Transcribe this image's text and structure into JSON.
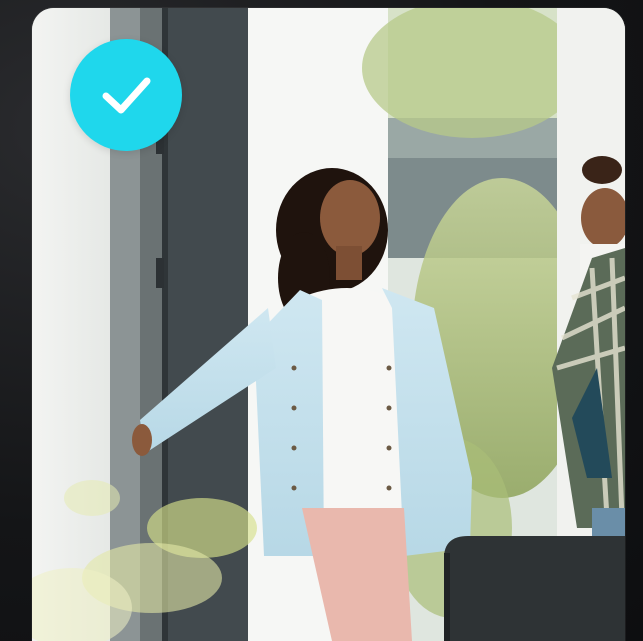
{
  "card": {
    "selected": true,
    "badge_icon": "checkmark-icon",
    "badge_color": "#1fd7ec"
  },
  "photo": {
    "subject": "woman-in-denim-shirt-at-doorway-with-child"
  },
  "colors": {
    "background": "#111214",
    "badge": "#1fd7ec",
    "check": "#ffffff"
  }
}
